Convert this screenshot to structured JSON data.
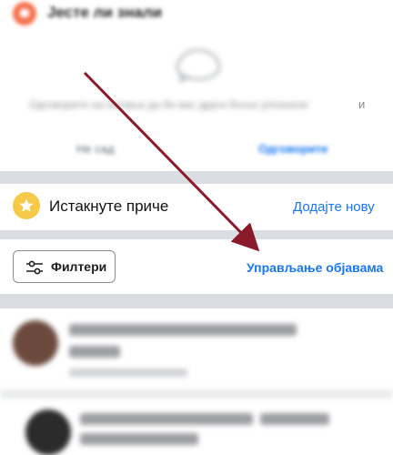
{
  "did_you_know": {
    "title": "Јесте ли знали",
    "prompt": "Одговорите на питања да би вас други боље упознали",
    "prompt_suffix": "и",
    "not_now": "Не сад",
    "answer": "Одговорите"
  },
  "highlights": {
    "label": "Истакнуте приче",
    "add_new": "Додајте нову"
  },
  "toolbar": {
    "filters": "Филтери",
    "manage_posts": "Управљање објавама"
  },
  "colors": {
    "accent_blue": "#1877f2",
    "did_you_know_icon": "#f5734f",
    "star_badge": "#f7c948",
    "annotation_arrow": "#8b1a2b",
    "separator": "#dadde1"
  },
  "icons": {
    "did_you_know": "chat-bubble-icon",
    "empty_state": "speech-bubble-icon",
    "highlights": "star-icon",
    "filters": "sliders-icon"
  }
}
